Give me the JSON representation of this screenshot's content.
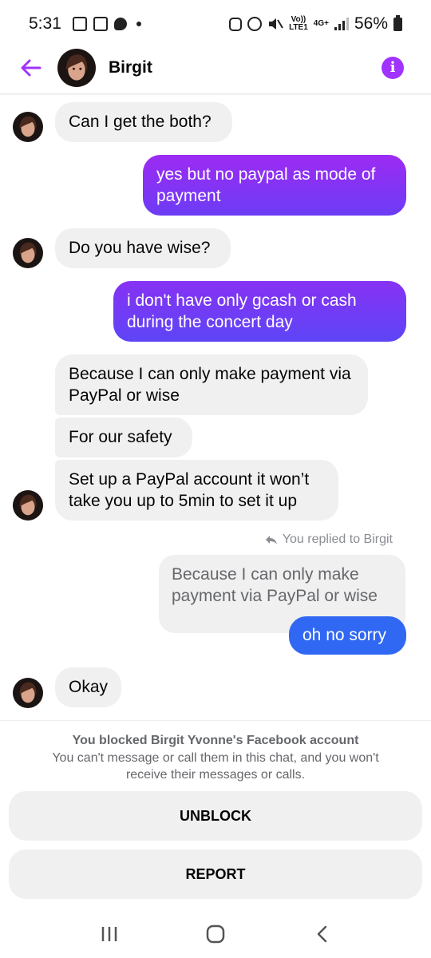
{
  "status_bar": {
    "time": "5:31",
    "net_top": "Vo))",
    "net_bottom": "LTE1",
    "gen": "4G+",
    "battery": "56%"
  },
  "header": {
    "contact_name": "Birgit"
  },
  "messages": [
    {
      "direction": "in",
      "text": "Can I get the both?"
    },
    {
      "direction": "out",
      "text": "yes but no paypal as mode of payment"
    },
    {
      "direction": "in",
      "text": "Do you have wise?"
    },
    {
      "direction": "out",
      "text": "i don't have only gcash or cash during the concert day"
    },
    {
      "direction": "in",
      "text": "Because I can only make payment via PayPal or wise"
    },
    {
      "direction": "in",
      "text": "For our safety"
    },
    {
      "direction": "in",
      "text": "Set up a PayPal account it won’t take you up to 5min to set it up"
    },
    {
      "direction": "out",
      "text": "oh no sorry"
    },
    {
      "direction": "in",
      "text": "Okay"
    }
  ],
  "reply": {
    "label": "You replied to Birgit",
    "quoted_text": "Because I can only make payment via PayPal or wise"
  },
  "blocked": {
    "title": "You blocked Birgit Yvonne's Facebook account",
    "description": "You can't message or call them in this chat, and you won't receive their messages or calls.",
    "unblock_label": "UNBLOCK",
    "report_label": "REPORT"
  },
  "colors": {
    "accent": "#a033ff",
    "outgoing_gradient_top": "#9d2bf3",
    "outgoing_gradient_bottom": "#6c3cf5",
    "outgoing_blue": "#3168f3",
    "incoming_bg": "#f0f0f0"
  },
  "icons": [
    "back-arrow-icon",
    "info-icon",
    "reply-icon",
    "recent-apps-icon",
    "home-icon",
    "nav-back-icon"
  ]
}
